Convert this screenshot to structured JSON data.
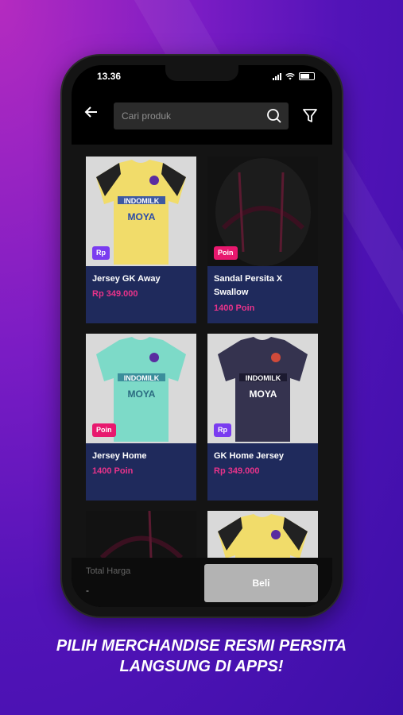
{
  "status": {
    "time": "13.36"
  },
  "search": {
    "placeholder": "Cari produk"
  },
  "products": [
    {
      "name": "Jersey GK Away",
      "price": "Rp 349.000",
      "badge": "Rp",
      "jersey_color": "#f1dc6a",
      "sponsor": "INDOMILK",
      "sponsor2": "MOYA"
    },
    {
      "name": "Sandal Persita X Swallow",
      "price": "1400 Poin",
      "badge": "Poin"
    },
    {
      "name": "Jersey Home",
      "price": "1400 Poin",
      "badge": "Poin",
      "jersey_color": "#7ddac8",
      "sponsor": "INDOMILK",
      "sponsor2": "MOYA"
    },
    {
      "name": "GK Home Jersey",
      "price": "Rp 349.000",
      "badge": "Rp",
      "jersey_color": "#35334f",
      "sponsor": "INDOMILK",
      "sponsor2": "MOYA"
    }
  ],
  "footer": {
    "total_label": "Total Harga",
    "total_value": "-",
    "buy_label": "Beli"
  },
  "tagline": {
    "line1": "PILIH MERCHANDISE RESMI PERSITA",
    "line2": "LANGSUNG DI APPS!"
  },
  "colors": {
    "card_info": "#1f2a5c",
    "price": "#e8338a",
    "badge_rp": "#7a3cf0",
    "badge_poin": "#e8186e",
    "buy_button": "#b3b3b3"
  }
}
